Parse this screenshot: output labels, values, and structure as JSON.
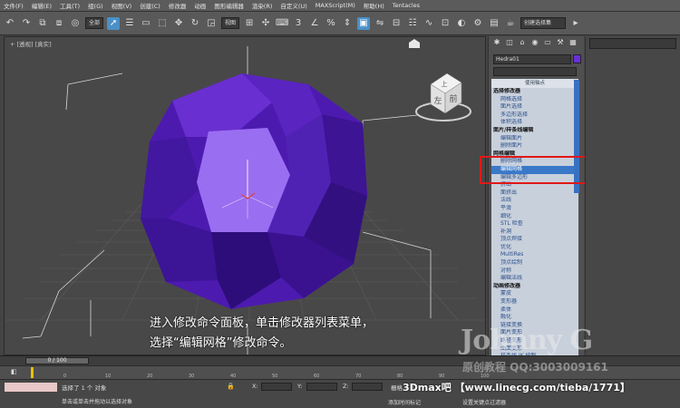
{
  "menu": [
    "文件(F)",
    "编辑(E)",
    "工具(T)",
    "组(G)",
    "视图(V)",
    "创建(C)",
    "修改器",
    "动画",
    "图形编辑器",
    "渲染(R)",
    "自定义(U)",
    "MAXScript(M)",
    "帮助(H)",
    "Tentacles"
  ],
  "toolbar": {
    "selection_filter": "全部",
    "ref_coord": "视图",
    "named_sel": "创建选择集"
  },
  "viewport": {
    "label": "+ [透视] [真实]",
    "viewcube_top": "上",
    "viewcube_front": "前",
    "viewcube_left": "左",
    "caption_line1": "进入修改命令面板，单击修改器列表菜单，",
    "caption_line2": "选择“编辑网格”修改命令。",
    "colors": {
      "object": "#5a1fc0",
      "object_highlight": "#9a6ef0"
    }
  },
  "command_panel": {
    "object_name": "Hedra01",
    "modifier_list_header": "使用轴点",
    "items": [
      {
        "label": "选择修改器",
        "type": "cat"
      },
      {
        "label": "网格选择",
        "type": "item"
      },
      {
        "label": "面片选择",
        "type": "item"
      },
      {
        "label": "多边形选择",
        "type": "item"
      },
      {
        "label": "体积选择",
        "type": "item"
      },
      {
        "label": "面片/样条线编辑",
        "type": "cat"
      },
      {
        "label": "编辑面片",
        "type": "item"
      },
      {
        "label": "删除面片",
        "type": "item"
      },
      {
        "label": "网格编辑",
        "type": "cat"
      },
      {
        "label": "删除网格",
        "type": "item"
      },
      {
        "label": "编辑网格",
        "type": "sel"
      },
      {
        "label": "编辑多边形",
        "type": "item"
      },
      {
        "label": "挤出",
        "type": "item"
      },
      {
        "label": "面挤出",
        "type": "item"
      },
      {
        "label": "法线",
        "type": "item"
      },
      {
        "label": "平滑",
        "type": "item"
      },
      {
        "label": "细化",
        "type": "item"
      },
      {
        "label": "STL 检查",
        "type": "item"
      },
      {
        "label": "补洞",
        "type": "item"
      },
      {
        "label": "顶点焊接",
        "type": "item"
      },
      {
        "label": "优化",
        "type": "item"
      },
      {
        "label": "MultiRes",
        "type": "item"
      },
      {
        "label": "顶点绘制",
        "type": "item"
      },
      {
        "label": "对称",
        "type": "item"
      },
      {
        "label": "编辑法线",
        "type": "item"
      },
      {
        "label": "动画修改器",
        "type": "cat"
      },
      {
        "label": "蒙皮",
        "type": "item"
      },
      {
        "label": "变形器",
        "type": "item"
      },
      {
        "label": "柔体",
        "type": "item"
      },
      {
        "label": "融化",
        "type": "item"
      },
      {
        "label": "链接变换",
        "type": "item"
      },
      {
        "label": "面片变形",
        "type": "item"
      },
      {
        "label": "路径变形",
        "type": "item"
      },
      {
        "label": "曲面变形",
        "type": "item"
      },
      {
        "label": "样条线 IK 控制",
        "type": "item"
      },
      {
        "label": "UV 坐标修改器",
        "type": "cat"
      },
      {
        "label": "UVW 贴图",
        "type": "item"
      },
      {
        "label": "贴图缩放器",
        "type": "item"
      }
    ]
  },
  "timeline": {
    "slider": "0 / 100",
    "ticks": [
      "0",
      "10",
      "20",
      "30",
      "40",
      "50",
      "60",
      "70",
      "80",
      "90",
      "100"
    ]
  },
  "status": {
    "selected": "选择了 1 个 对象",
    "hint": "单击或单击并拖动以选择对象",
    "grid": "栅格 = 1",
    "x_label": "X:",
    "y_label": "Y:",
    "z_label": "Z:",
    "add_time_tag": "添加时间标记",
    "key_filter": "设置关键点过滤器"
  },
  "watermark": {
    "name": "Johnny G",
    "sub": "原创教程 QQ:3003009161",
    "url": "3Dmax吧 【www.linecg.com/tieba/1771】"
  }
}
